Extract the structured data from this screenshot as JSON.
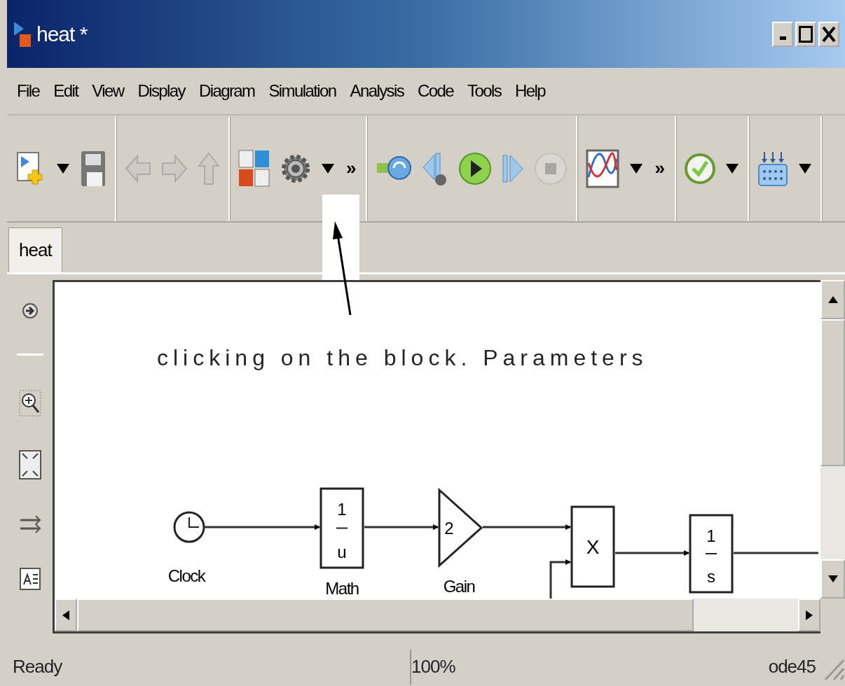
{
  "window": {
    "title": "heat *"
  },
  "menu": [
    "File",
    "Edit",
    "View",
    "Display",
    "Diagram",
    "Simulation",
    "Analysis",
    "Code",
    "Tools",
    "Help"
  ],
  "toolbar": {
    "groups": [
      {
        "items": [
          {
            "kind": "new-model",
            "dropdown": true,
            "disabled": false
          },
          {
            "kind": "save",
            "dropdown": false,
            "disabled": false
          }
        ]
      },
      {
        "items": [
          {
            "kind": "back",
            "dropdown": false,
            "disabled": true
          },
          {
            "kind": "forward",
            "dropdown": false,
            "disabled": true
          },
          {
            "kind": "up",
            "dropdown": false,
            "disabled": true
          }
        ]
      },
      {
        "items": [
          {
            "kind": "library",
            "dropdown": false,
            "disabled": false
          },
          {
            "kind": "settings",
            "dropdown": true,
            "disabled": false
          },
          {
            "kind": "overflow",
            "text": "»"
          }
        ]
      },
      {
        "items": [
          {
            "kind": "build",
            "dropdown": false,
            "disabled": false
          },
          {
            "kind": "step-back",
            "dropdown": false,
            "disabled": false
          },
          {
            "kind": "run",
            "dropdown": false,
            "disabled": false
          },
          {
            "kind": "step-forward",
            "dropdown": false,
            "disabled": false
          },
          {
            "kind": "stop",
            "dropdown": false,
            "disabled": true
          }
        ]
      },
      {
        "items": [
          {
            "kind": "scope",
            "dropdown": true,
            "disabled": false
          },
          {
            "kind": "overflow",
            "text": "»"
          }
        ]
      },
      {
        "items": [
          {
            "kind": "check",
            "dropdown": true,
            "disabled": false
          }
        ]
      },
      {
        "items": [
          {
            "kind": "inputs",
            "dropdown": true,
            "disabled": false
          }
        ]
      }
    ]
  },
  "tabs": [
    {
      "label": "heat",
      "selected": true
    }
  ],
  "annotation": {
    "text": "clicking on the block. Parameters"
  },
  "diagram": {
    "blocks": [
      {
        "kind": "clock",
        "label": "Clock"
      },
      {
        "kind": "fraction",
        "numerator": "1",
        "denominator": "u",
        "label": "Math"
      },
      {
        "kind": "gain",
        "value": "2",
        "label": "Gain"
      },
      {
        "kind": "product",
        "symbol": "X"
      },
      {
        "kind": "fraction",
        "numerator": "1",
        "denominator": "s"
      }
    ]
  },
  "status_bar": {
    "status": "Ready",
    "zoom": "100%",
    "solver": "ode45"
  }
}
